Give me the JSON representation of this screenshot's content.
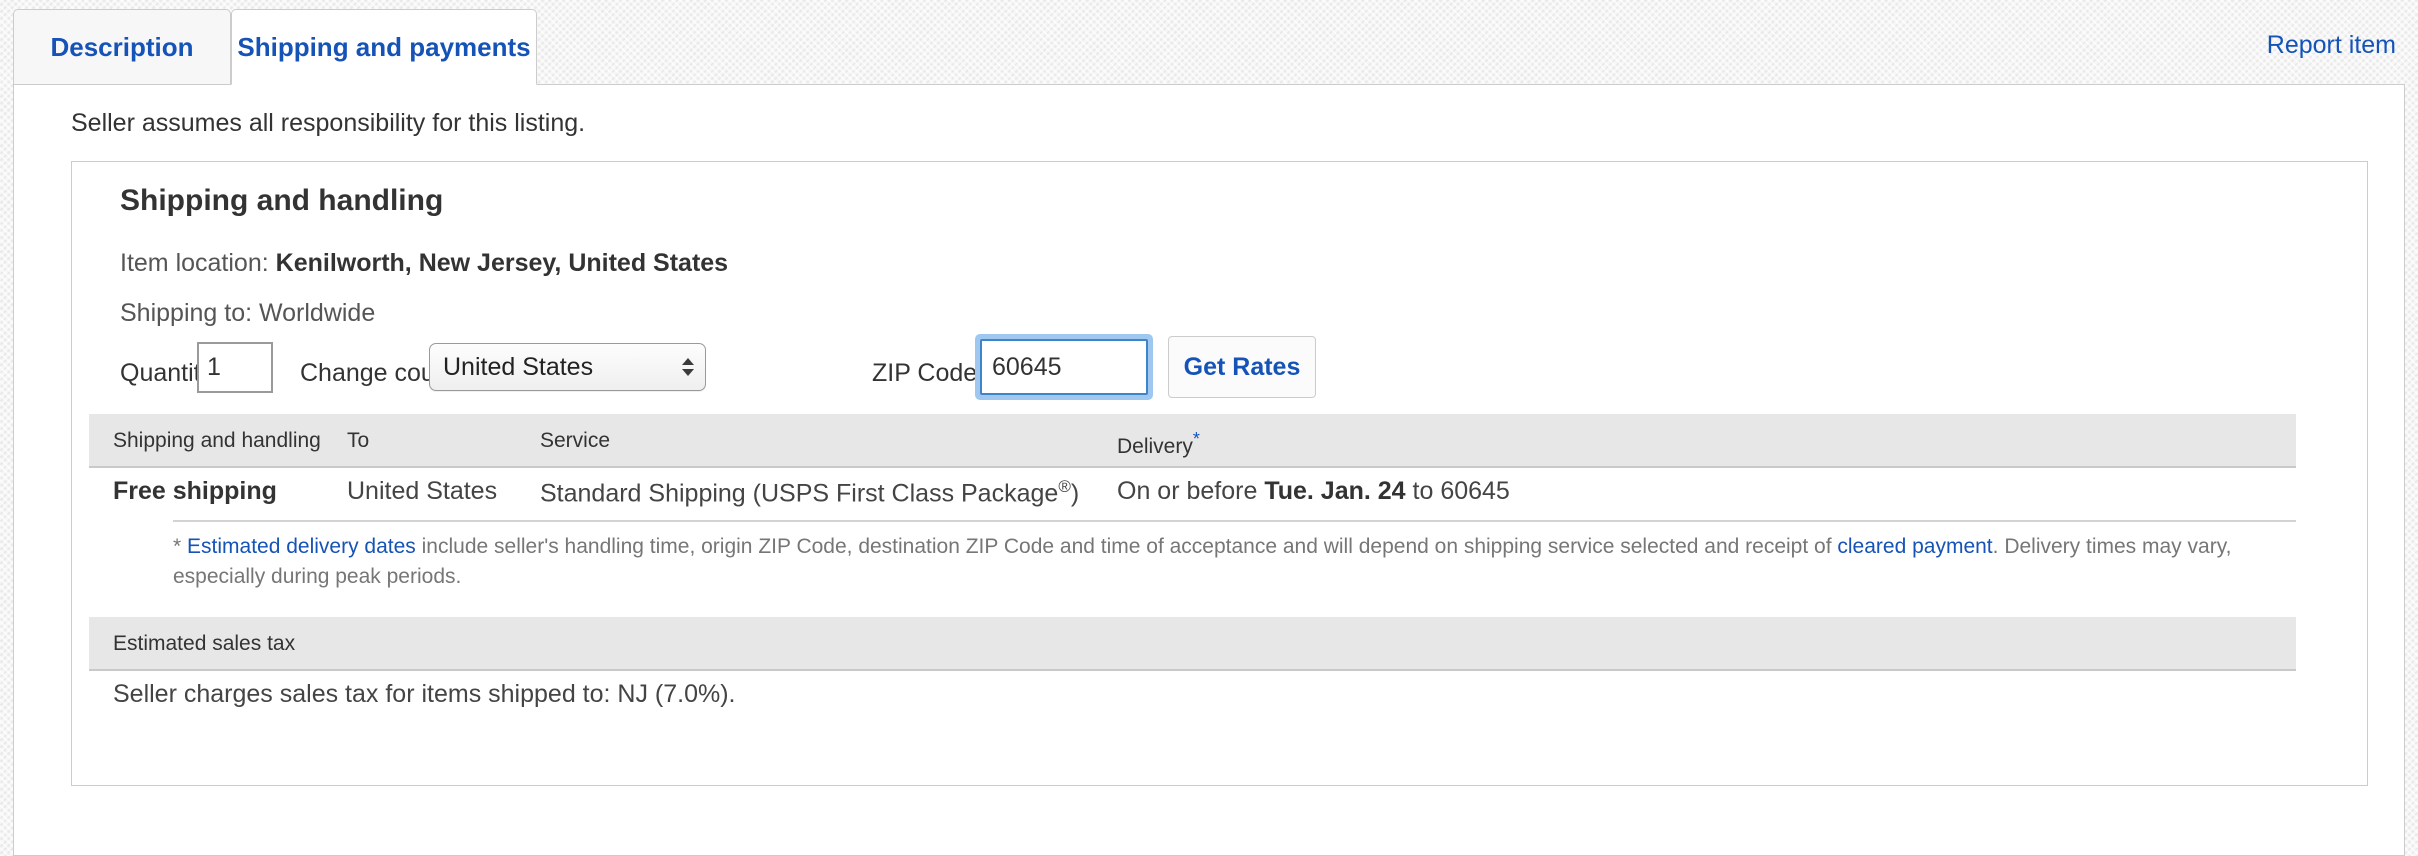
{
  "tabs": [
    {
      "label": "Description",
      "active": false
    },
    {
      "label": "Shipping and payments",
      "active": true
    }
  ],
  "header": {
    "report_item_label": "Report item"
  },
  "content": {
    "seller_note": "Seller assumes all responsibility for this listing."
  },
  "shipping_card": {
    "title": "Shipping and handling",
    "item_location_label": "Item location:",
    "item_location_value": "Kenilworth, New Jersey, United States",
    "shipping_to": "Shipping to: Worldwide",
    "form": {
      "quantity_label": "Quantity:",
      "quantity_value": "1",
      "change_country_label": "Change country:",
      "country_value": "United States",
      "zip_label": "ZIP Code:",
      "zip_value": "60645",
      "get_rates_label": "Get Rates"
    },
    "table": {
      "headers": [
        "Shipping and handling",
        "To",
        "Service",
        "Delivery"
      ],
      "delivery_header_marker": "*",
      "row": {
        "cost": "Free shipping",
        "to": "United States",
        "service_prefix": "Standard Shipping (USPS First Class Package",
        "service_mark": "®",
        "service_suffix": ")",
        "delivery_prefix": "On or before ",
        "delivery_date": "Tue. Jan. 24",
        "delivery_suffix": " to 60645"
      }
    },
    "footnote": {
      "marker": "* ",
      "link1": "Estimated delivery dates",
      "text1": " include seller's handling time, origin ZIP Code, destination ZIP Code and time of acceptance and will depend on shipping service selected and receipt of ",
      "link2": "cleared payment",
      "text2": ". Delivery times may vary, especially during peak periods."
    },
    "sales_tax": {
      "header": "Estimated sales tax",
      "body": "Seller charges sales tax for items shipped to: NJ (7.0%)."
    }
  }
}
